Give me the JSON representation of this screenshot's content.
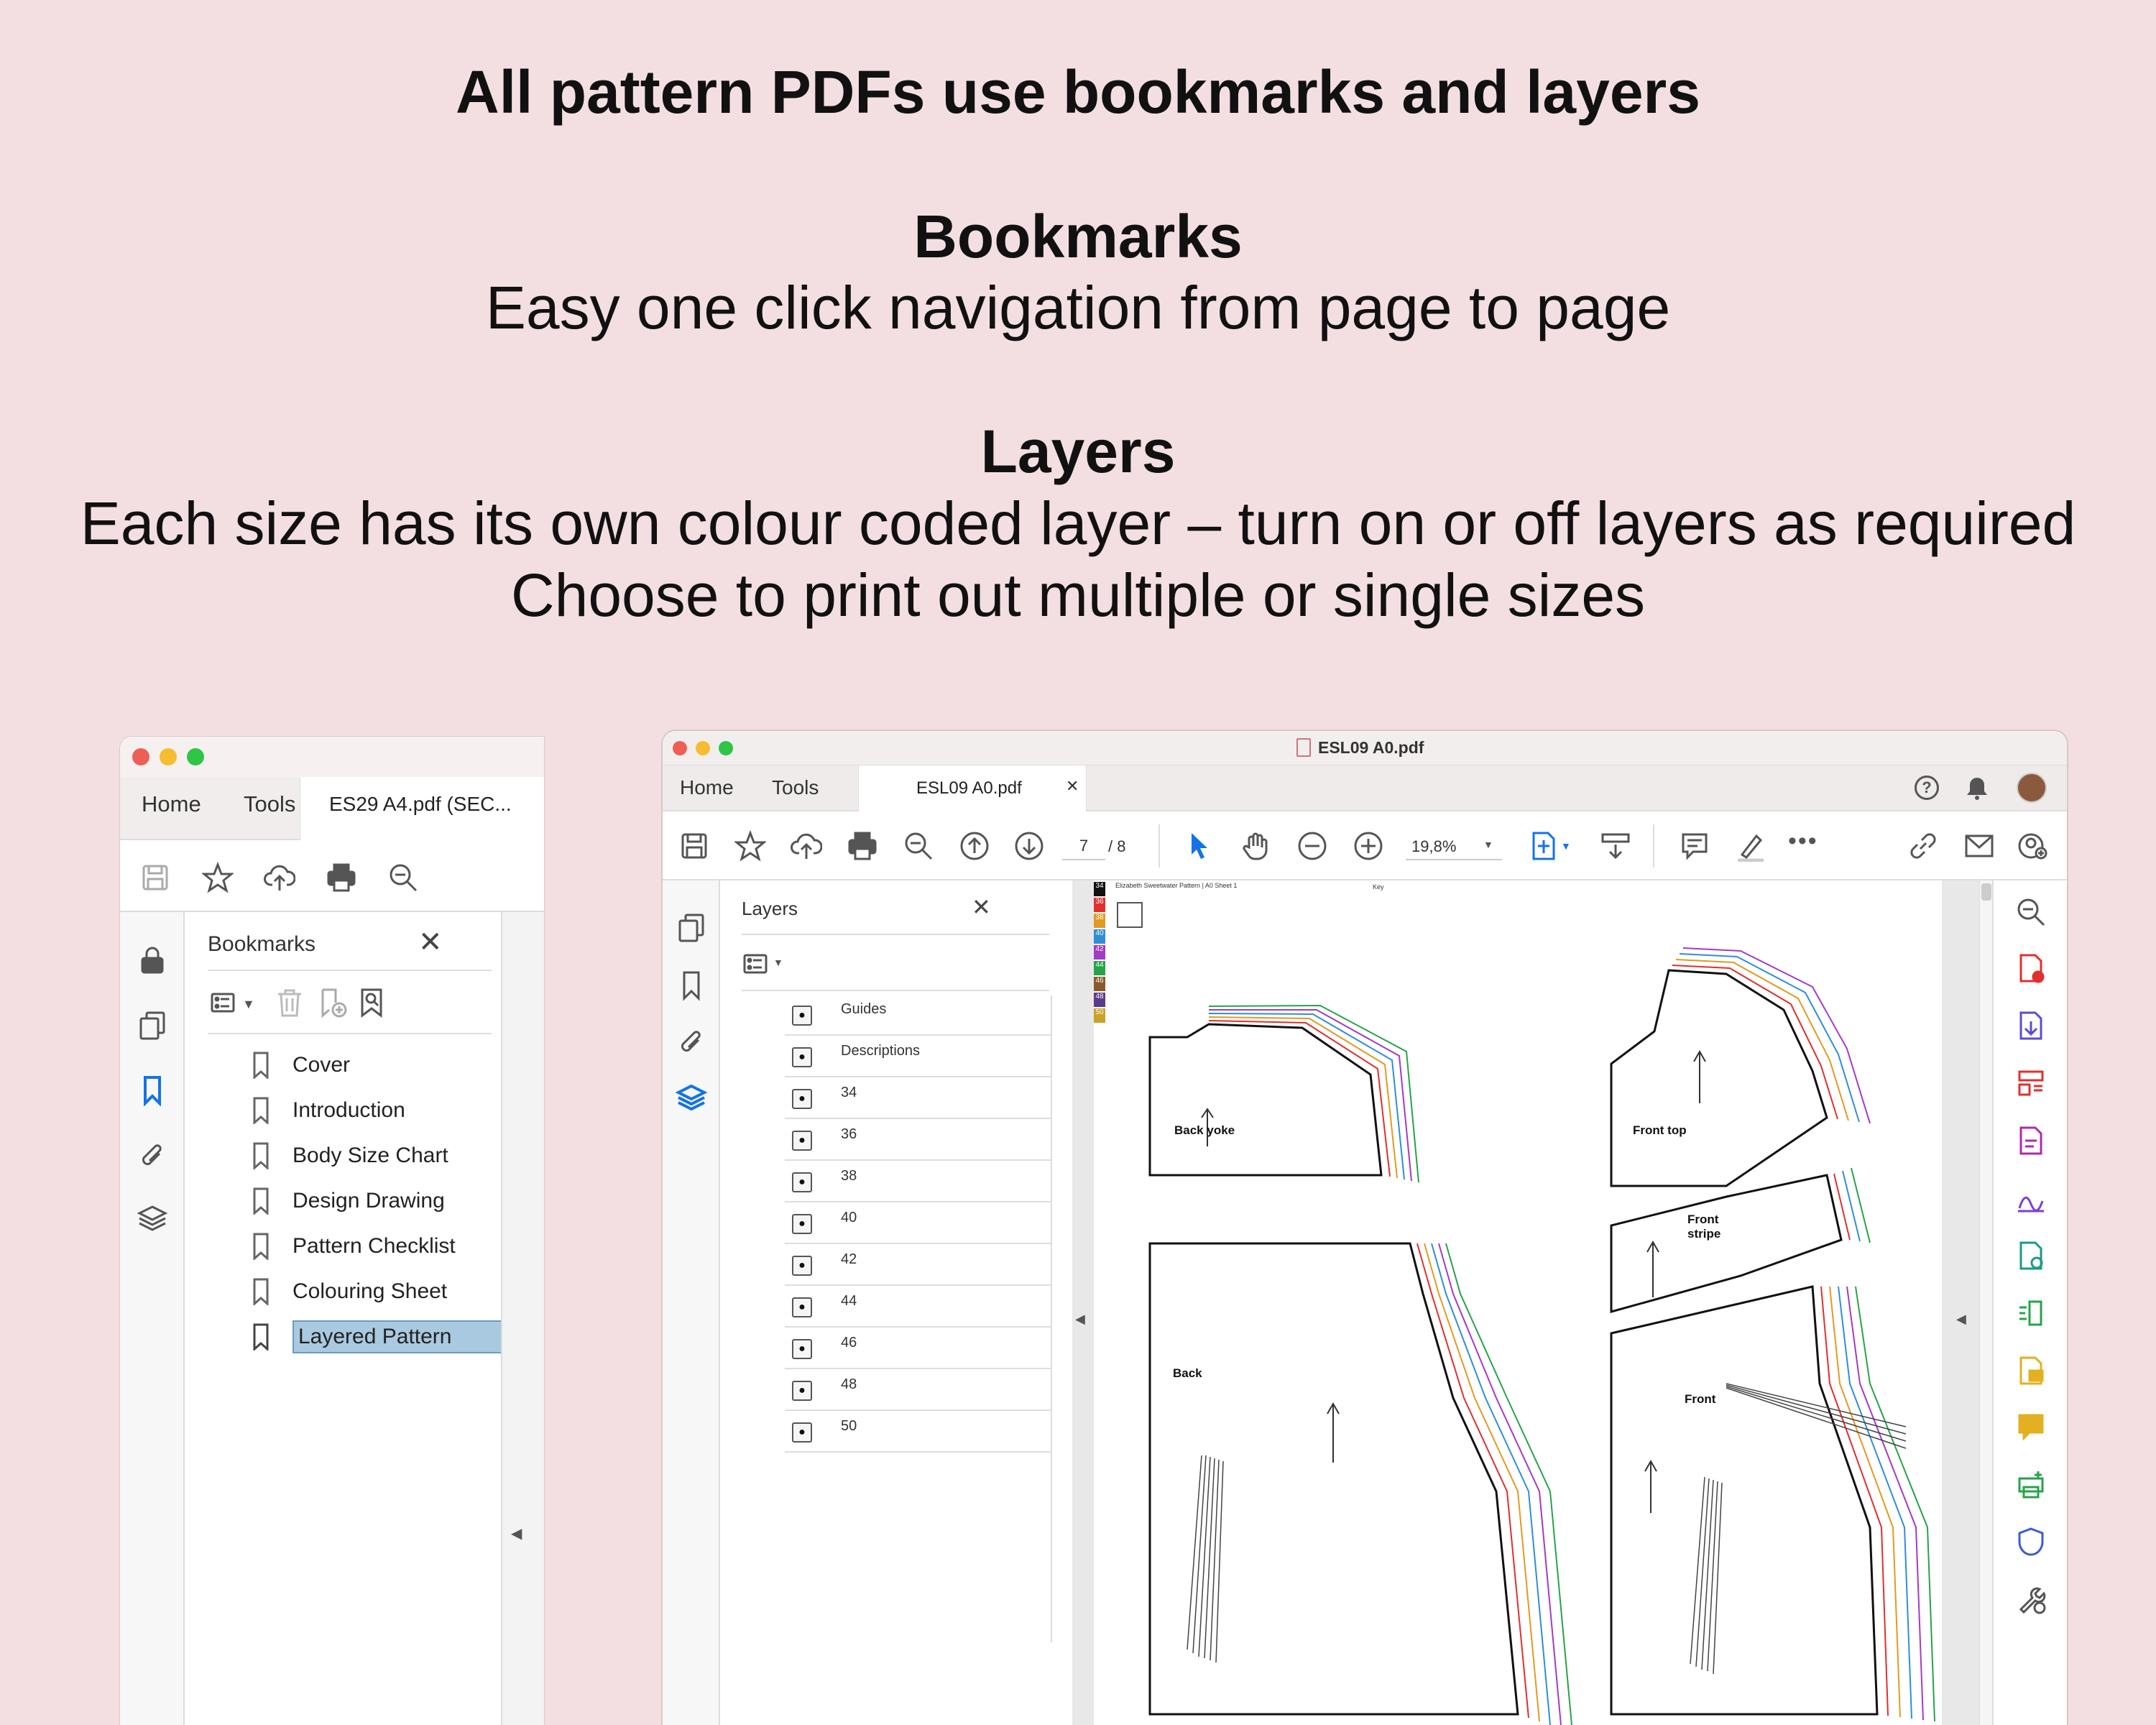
{
  "headline": "All pattern PDFs use bookmarks and layers",
  "bookmarks_section": {
    "title": "Bookmarks",
    "desc": "Easy one click navigation from page to page"
  },
  "layers_section": {
    "title": "Layers",
    "desc1": "Each size has its own colour coded layer – turn on or off layers as required",
    "desc2": "Choose to print out multiple or single sizes"
  },
  "left_window": {
    "tabs": {
      "home": "Home",
      "tools": "Tools",
      "doc": "ES29 A4.pdf (SEC..."
    },
    "panel_title": "Bookmarks",
    "bookmarks": [
      {
        "label": "Cover",
        "selected": false
      },
      {
        "label": "Introduction",
        "selected": false
      },
      {
        "label": "Body Size Chart",
        "selected": false
      },
      {
        "label": "Design Drawing",
        "selected": false
      },
      {
        "label": "Pattern Checklist",
        "selected": false
      },
      {
        "label": "Colouring Sheet",
        "selected": false
      },
      {
        "label": "Layered Pattern",
        "selected": true
      }
    ]
  },
  "right_window": {
    "title": "ESL09 A0.pdf",
    "tabs": {
      "home": "Home",
      "tools": "Tools",
      "doc": "ESL09 A0.pdf"
    },
    "page_current": "7",
    "page_total": "/ 8",
    "zoom": "19,8%",
    "panel_title": "Layers",
    "layers": [
      "Guides",
      "Descriptions",
      "34",
      "36",
      "38",
      "40",
      "42",
      "44",
      "46",
      "48",
      "50"
    ],
    "pattern": {
      "header": "Elizabeth Sweetwater Pattern | A0 Sheet 1",
      "key": "Key",
      "sizes": [
        "34",
        "36",
        "38",
        "40",
        "42",
        "44",
        "46",
        "48",
        "50"
      ],
      "size_colors": [
        "#111111",
        "#e0302e",
        "#e39a22",
        "#2e8fd6",
        "#a23bc7",
        "#27a34a",
        "#8a5a2b",
        "#5a3b8a",
        "#c9a227"
      ],
      "pieces": {
        "back_yoke": "Back yoke",
        "front_top": "Front top",
        "front_stripe": "Front\nstripe",
        "back": "Back",
        "front": "Front"
      }
    }
  },
  "colors": {
    "background": "#f3dfe1",
    "accent": "#1473e6",
    "selection": "#a9c9e0"
  }
}
